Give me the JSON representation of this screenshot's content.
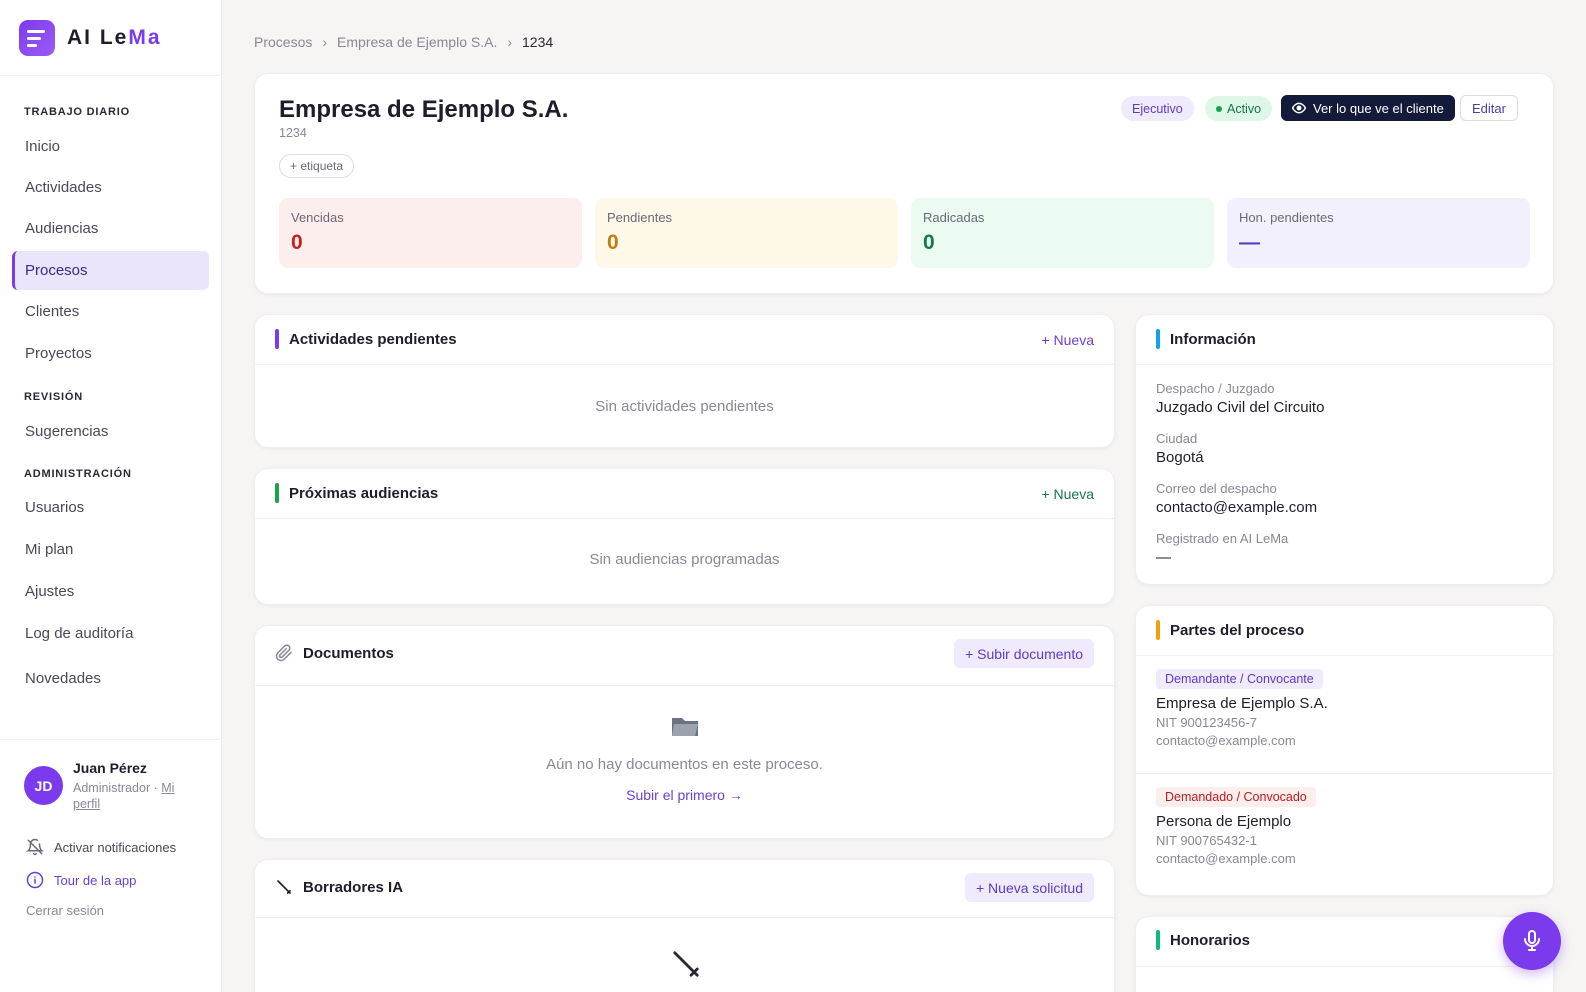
{
  "brand": {
    "name_part1": "AI Le",
    "name_part2": "Ma"
  },
  "sidebar": {
    "sections": [
      "TRABAJO DIARIO",
      "REVISIÓN",
      "ADMINISTRACIÓN"
    ],
    "items": [
      {
        "label": "Inicio"
      },
      {
        "label": "Actividades"
      },
      {
        "label": "Audiencias"
      },
      {
        "label": "Procesos",
        "active": true
      },
      {
        "label": "Clientes"
      },
      {
        "label": "Proyectos"
      },
      {
        "label": "Sugerencias"
      },
      {
        "label": "Usuarios"
      },
      {
        "label": "Mi plan"
      },
      {
        "label": "Ajustes"
      },
      {
        "label": "Log de auditoría"
      },
      {
        "label": "Novedades"
      }
    ],
    "user": {
      "initials": "JD",
      "name": "Juan Pérez",
      "role": "Administrador · ",
      "profile_link": "Mi perfil"
    },
    "notifications": "Activar notificaciones",
    "tour": "Tour de la app",
    "logout": "Cerrar sesión"
  },
  "breadcrumb": [
    "Procesos",
    "Empresa de Ejemplo S.A.",
    "1234"
  ],
  "header": {
    "title": "Empresa de Ejemplo S.A.",
    "number": "1234",
    "tag_button": "+ etiqueta",
    "pill_exec": "Ejecutivo",
    "pill_status": "Activo",
    "client_view_button": "Ver lo que ve el cliente",
    "edit_button": "Editar",
    "stats": [
      {
        "label": "Vencidas",
        "value": "0",
        "bg": "#fdeeee",
        "color": "#c81e1e"
      },
      {
        "label": "Pendientes",
        "value": "0",
        "bg": "#fdf8e8",
        "color": "#c27d0e"
      },
      {
        "label": "Radicadas",
        "value": "0",
        "bg": "#ecfbf1",
        "color": "#13794a"
      },
      {
        "label": "Hon. pendientes",
        "value": "—",
        "bg": "#f3f0fd",
        "color": "#5b3cc4"
      }
    ]
  },
  "activities": {
    "title": "Actividades pendientes",
    "new": "+ Nueva",
    "empty": "Sin actividades pendientes"
  },
  "hearings": {
    "title": "Próximas audiencias",
    "new": "+ Nueva",
    "empty": "Sin audiencias programadas"
  },
  "documents": {
    "title": "Documentos",
    "upload": "+ Subir documento",
    "empty": "Aún no hay documentos en este proceso.",
    "first_link": "Subir el primero →"
  },
  "drafts": {
    "title": "Borradores IA",
    "new_request": "+ Nueva solicitud"
  },
  "info": {
    "title": "Información",
    "rows": [
      {
        "label": "Despacho / Juzgado",
        "value": "Juzgado Civil del Circuito"
      },
      {
        "label": "Ciudad",
        "value": "Bogotá"
      },
      {
        "label": "Correo del despacho",
        "value": "contacto@example.com"
      },
      {
        "label": "Registrado en AI LeMa",
        "value": "—"
      }
    ]
  },
  "parties": {
    "title": "Partes del proceso",
    "list": [
      {
        "role": "Demandante / Convocante",
        "name": "Empresa de Ejemplo S.A.",
        "nit": "NIT 900123456-7",
        "email": "contacto@example.com"
      },
      {
        "role": "Demandado / Convocado",
        "name": "Persona de Ejemplo",
        "nit": "NIT 900765432-1",
        "email": "contacto@example.com"
      }
    ]
  },
  "fees": {
    "title": "Honorarios"
  },
  "colors": {
    "accent": "#7c3aed",
    "green": "#16a34a",
    "blue": "#0ea5e9",
    "amber": "#f59e0b",
    "dark": "#141b3a"
  },
  "icons": [
    "menu-lines-icon",
    "chevron-right-icon",
    "eye-icon",
    "paperclip-icon",
    "folder-icon",
    "pen-icon",
    "bell-off-icon",
    "info-circle-icon",
    "microphone-icon"
  ]
}
